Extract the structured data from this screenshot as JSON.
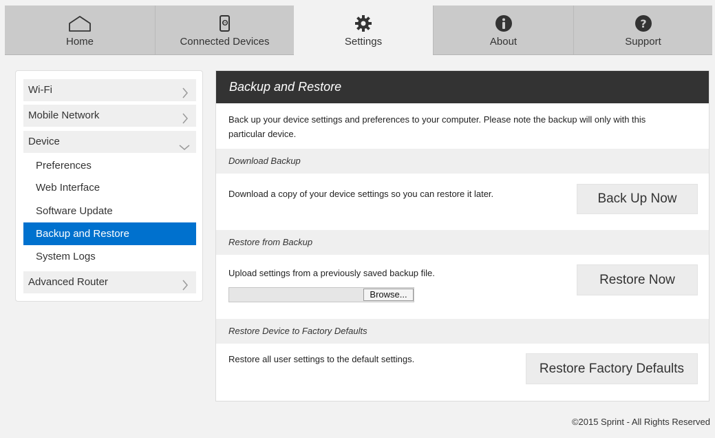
{
  "nav": {
    "tabs": [
      {
        "label": "Home",
        "icon": "home-icon"
      },
      {
        "label": "Connected Devices",
        "icon": "connected-devices-icon"
      },
      {
        "label": "Settings",
        "icon": "gear-icon",
        "active": true
      },
      {
        "label": "About",
        "icon": "info-icon"
      },
      {
        "label": "Support",
        "icon": "help-icon"
      }
    ]
  },
  "sidebar": {
    "items": {
      "wifi": "Wi-Fi",
      "mobile_network": "Mobile Network",
      "device": "Device",
      "advanced_router": "Advanced Router"
    },
    "device_sub": [
      "Preferences",
      "Web Interface",
      "Software Update",
      "Backup and Restore",
      "System Logs"
    ],
    "active_sub": "Backup and Restore"
  },
  "main": {
    "title": "Backup and Restore",
    "intro": "Back up your device settings and preferences to your computer. Please note the backup will only with this particular device.",
    "download": {
      "heading": "Download Backup",
      "text": "Download a copy of your device settings so you can restore it later.",
      "button": "Back Up Now"
    },
    "restore": {
      "heading": "Restore from Backup",
      "text": "Upload settings from a previously saved backup file.",
      "browse": "Browse...",
      "button": "Restore Now"
    },
    "factory": {
      "heading": "Restore Device to Factory Defaults",
      "text": "Restore all user settings to the default settings.",
      "button": "Restore Factory Defaults"
    }
  },
  "footer": "©2015 Sprint - All Rights Reserved",
  "colors": {
    "accent": "#0071ce",
    "header": "#333333",
    "nav_bg": "#cacaca"
  }
}
